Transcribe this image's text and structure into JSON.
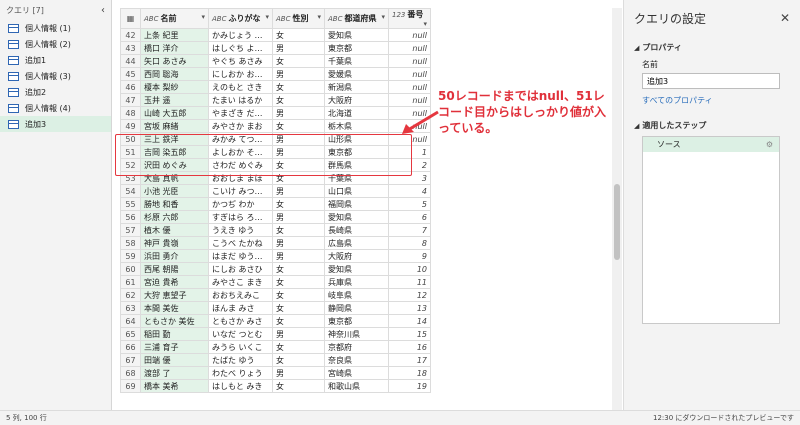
{
  "queries": {
    "header": "クエリ [7]",
    "items": [
      "個人情報 (1)",
      "個人情報 (2)",
      "追加1",
      "個人情報 (3)",
      "追加2",
      "個人情報 (4)",
      "追加3"
    ],
    "selected_index": 6
  },
  "grid": {
    "columns": [
      {
        "type": "ABC",
        "label": "名前"
      },
      {
        "type": "ABC",
        "label": "ふりがな"
      },
      {
        "type": "ABC",
        "label": "性別"
      },
      {
        "type": "ABC",
        "label": "都道府県"
      },
      {
        "type": "123",
        "label": "番号"
      }
    ],
    "rows": [
      [
        "42",
        "上条 紀里",
        "かみじょう ゆ…",
        "女",
        "愛知県",
        "null"
      ],
      [
        "43",
        "橋口 洋介",
        "はしぐち よう…",
        "男",
        "東京都",
        "null"
      ],
      [
        "44",
        "矢口 あさみ",
        "やぐち あさみ",
        "女",
        "千葉県",
        "null"
      ],
      [
        "45",
        "西岡 聡海",
        "にしおか おう…",
        "男",
        "愛媛県",
        "null"
      ],
      [
        "46",
        "榎本 梨紗",
        "えのもと さき",
        "女",
        "新潟県",
        "null"
      ],
      [
        "47",
        "玉井 遥",
        "たまい はるか",
        "女",
        "大阪府",
        "null"
      ],
      [
        "48",
        "山崎 大五郎",
        "やまざき だい…",
        "男",
        "北海道",
        "null"
      ],
      [
        "49",
        "宮坂 麻緒",
        "みやさか まお",
        "女",
        "栃木県",
        "null"
      ],
      [
        "50",
        "三上 鉄洋",
        "みかみ てつひ…",
        "男",
        "山形県",
        "null"
      ],
      [
        "51",
        "吉岡 染五郎",
        "よしおか そめ…",
        "男",
        "東京都",
        "1"
      ],
      [
        "52",
        "沢田 めぐみ",
        "さわだ めぐみ",
        "女",
        "群馬県",
        "2"
      ],
      [
        "53",
        "大島 真帆",
        "おおしま まほ",
        "女",
        "千葉県",
        "3"
      ],
      [
        "54",
        "小池 光臣",
        "こいけ みつお…",
        "男",
        "山口県",
        "4"
      ],
      [
        "55",
        "勝地 和香",
        "かつぢ わか",
        "女",
        "福岡県",
        "5"
      ],
      [
        "56",
        "杉原 六郎",
        "すぎはら ろく…",
        "男",
        "愛知県",
        "6"
      ],
      [
        "57",
        "植木 優",
        "うえき ゆう",
        "女",
        "長崎県",
        "7"
      ],
      [
        "58",
        "神戸 貴嶺",
        "こうべ たかね",
        "男",
        "広島県",
        "8"
      ],
      [
        "59",
        "浜田 勇介",
        "はまだ ゆうす…",
        "男",
        "大阪府",
        "9"
      ],
      [
        "60",
        "西尾 朝陽",
        "にしお あさひ",
        "女",
        "愛知県",
        "10"
      ],
      [
        "61",
        "宮迫 貴希",
        "みやさこ まき",
        "女",
        "兵庫県",
        "11"
      ],
      [
        "62",
        "大狩 恵望子",
        "おおちえみこ",
        "女",
        "岐阜県",
        "12"
      ],
      [
        "63",
        "本間 美佐",
        "ほんま みさ",
        "女",
        "静岡県",
        "13"
      ],
      [
        "64",
        "ともさか 美佐",
        "ともさか みさ",
        "女",
        "東京都",
        "14"
      ],
      [
        "65",
        "稲田 勤",
        "いなだ つとむ",
        "男",
        "神奈川県",
        "15"
      ],
      [
        "66",
        "三浦 育子",
        "みうら いくこ",
        "女",
        "京都府",
        "16"
      ],
      [
        "67",
        "田端 優",
        "たばた ゆう",
        "女",
        "奈良県",
        "17"
      ],
      [
        "68",
        "渡部 了",
        "わたべ りょう",
        "男",
        "宮崎県",
        "18"
      ],
      [
        "69",
        "橋本 美希",
        "はしもと みき",
        "女",
        "和歌山県",
        "19"
      ]
    ]
  },
  "annotation": {
    "text": "50レコードまではnull、51レコード目からはしっかり値が入っている。"
  },
  "settings": {
    "title": "クエリの設定",
    "properties_label": "プロパティ",
    "name_label": "名前",
    "name_value": "追加3",
    "all_properties": "すべてのプロパティ",
    "applied_steps_label": "適用したステップ",
    "steps": [
      "ソース"
    ]
  },
  "status": {
    "left": "5 列, 100 行",
    "right": "12:30 にダウンロードされたプレビューです"
  },
  "colors": {
    "accent_red": "#e5373f",
    "selected_green": "#dcf0e4",
    "link_blue": "#2a6ebb"
  }
}
